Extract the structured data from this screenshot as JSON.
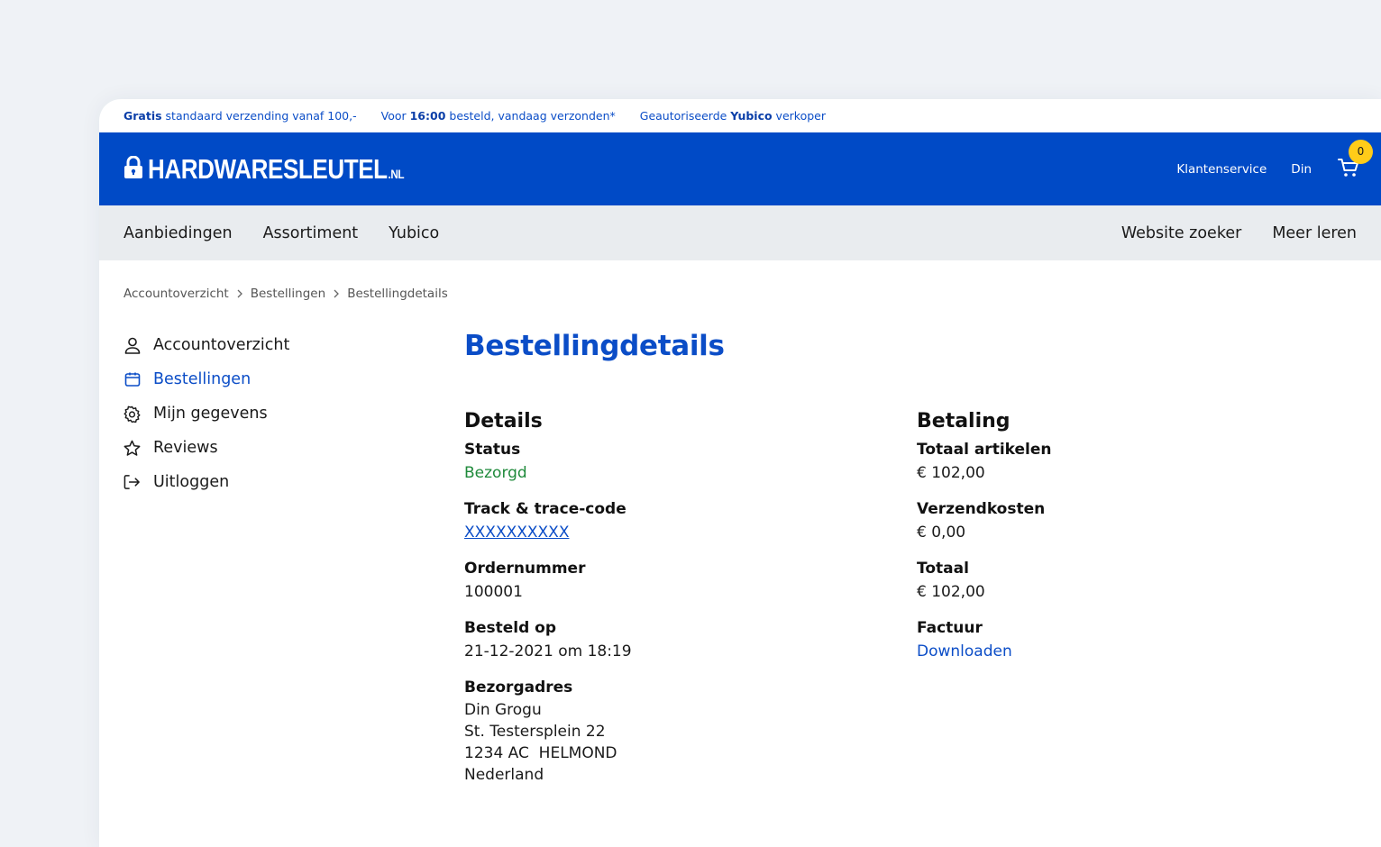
{
  "usp": {
    "item1_bold": "Gratis",
    "item1_rest": " standaard verzending vanaf 100,-",
    "item2_pre": "Voor ",
    "item2_bold": "16:00",
    "item2_rest": " besteld, vandaag verzonden*",
    "item3_pre": "Geautoriseerde ",
    "item3_bold": "Yubico",
    "item3_rest": " verkoper"
  },
  "header": {
    "logo_text": "HARDWARESLEUTEL",
    "logo_tld": ".NL",
    "customer_service": "Klantenservice",
    "user_name": "Din",
    "cart_count": "0"
  },
  "nav": {
    "left": [
      "Aanbiedingen",
      "Assortiment",
      "Yubico"
    ],
    "right": [
      "Website zoeker",
      "Meer leren"
    ]
  },
  "breadcrumb": [
    "Accountoverzicht",
    "Bestellingen",
    "Bestellingdetails"
  ],
  "sidemenu": [
    {
      "label": "Accountoverzicht",
      "icon": "user-icon"
    },
    {
      "label": "Bestellingen",
      "icon": "orders-icon"
    },
    {
      "label": "Mijn gegevens",
      "icon": "gear-icon"
    },
    {
      "label": "Reviews",
      "icon": "star-icon"
    },
    {
      "label": "Uitloggen",
      "icon": "logout-icon"
    }
  ],
  "page": {
    "title": "Bestellingdetails"
  },
  "details": {
    "heading": "Details",
    "status_label": "Status",
    "status_value": "Bezorgd",
    "track_label": "Track & trace-code",
    "track_value": "XXXXXXXXXX",
    "order_label": "Ordernummer",
    "order_value": "100001",
    "ordered_label": "Besteld op",
    "ordered_value": "21-12-2021 om 18:19",
    "address_label": "Bezorgadres",
    "address_lines": [
      "Din Grogu",
      "St. Testersplein 22",
      "1234 AC  HELMOND",
      "Nederland"
    ]
  },
  "payment": {
    "heading": "Betaling",
    "items_label": "Totaal artikelen",
    "items_value": "€ 102,00",
    "shipping_label": "Verzendkosten",
    "shipping_value": "€ 0,00",
    "total_label": "Totaal",
    "total_value": "€ 102,00",
    "invoice_label": "Factuur",
    "invoice_value": "Downloaden"
  },
  "colors": {
    "brand_blue": "#004ac6",
    "link_blue": "#0b4dc7",
    "status_green": "#1f8a3b",
    "badge_yellow": "#ffcc19"
  }
}
